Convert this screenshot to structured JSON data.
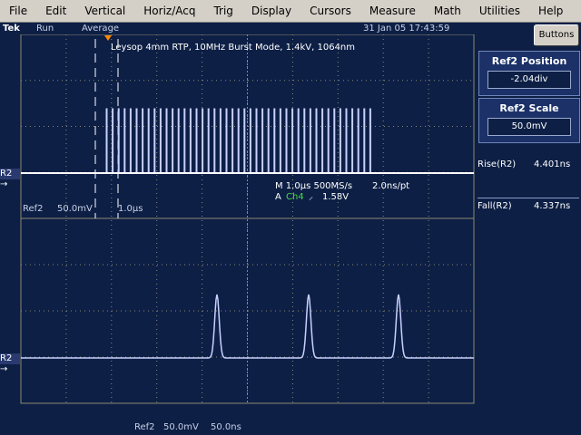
{
  "menu": [
    "File",
    "Edit",
    "Vertical",
    "Horiz/Acq",
    "Trig",
    "Display",
    "Cursors",
    "Measure",
    "Math",
    "Utilities",
    "Help"
  ],
  "status": {
    "brand": "Tek",
    "run": "Run",
    "mode": "Average",
    "datetime": "31 Jan 05 17:43:59"
  },
  "buttons_label": "Buttons",
  "ref2_position": {
    "title": "Ref2 Position",
    "value": "-2.04div"
  },
  "ref2_scale": {
    "title": "Ref2 Scale",
    "value": "50.0mV"
  },
  "measurements": [
    {
      "label": "Rise(R2)",
      "value": "4.401ns"
    },
    {
      "label": "Fall(R2)",
      "value": "4.337ns"
    }
  ],
  "upper": {
    "title": "Leysop 4mm RTP, 10MHz Burst Mode, 1.4kV, 1064nm",
    "timebase": "M 1.0μs 500MS/s",
    "samples": "2.0ns/pt",
    "trigger_prefix": "A",
    "trigger_channel": "Ch4",
    "trigger_level": "1.58V",
    "ref_label": "Ref2",
    "ref_scale": "50.0mV",
    "ref_time": "1.0μs",
    "marker": "R2"
  },
  "lower": {
    "marker": "R2",
    "ref_label": "Ref2",
    "ref_scale": "50.0mV",
    "ref_time": "50.0ns"
  },
  "colors": {
    "trace": "#c8d0ff",
    "grid": "#8a8a70",
    "trigger": "#ff8a00",
    "ch4": "#44dd44"
  }
}
